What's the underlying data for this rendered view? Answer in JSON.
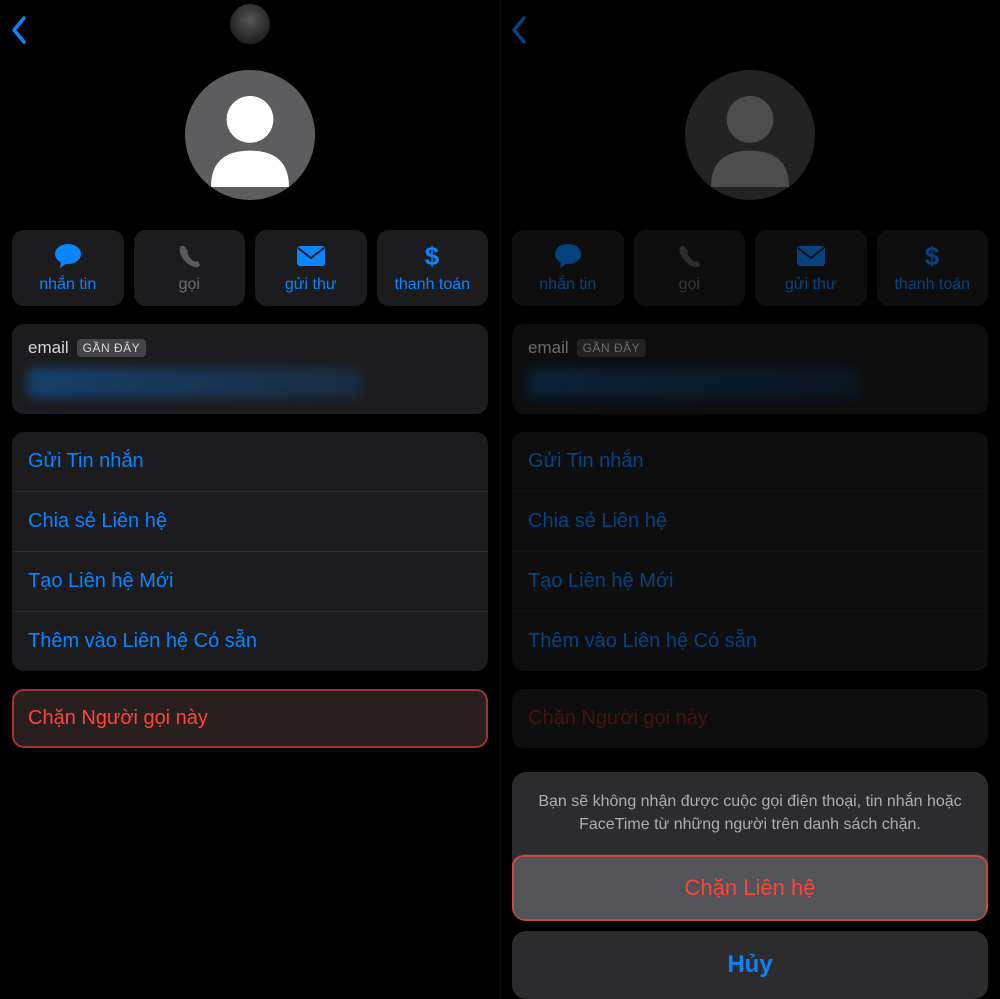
{
  "actions": {
    "message": "nhắn tin",
    "call": "gọi",
    "mail": "gửi thư",
    "pay": "thanh toán"
  },
  "email": {
    "label": "email",
    "badge": "GẦN ĐÂY"
  },
  "list": {
    "send_message": "Gửi Tin nhắn",
    "share_contact": "Chia sẻ Liên hệ",
    "create_contact": "Tạo Liên hệ Mới",
    "add_existing": "Thêm vào Liên hệ Có sẵn"
  },
  "block": {
    "label": "Chặn Người gọi này"
  },
  "sheet": {
    "message": "Bạn sẽ không nhận được cuộc gọi điện thoại, tin nhắn hoặc FaceTime từ những người trên danh sách chặn.",
    "confirm": "Chặn Liên hệ",
    "cancel": "Hủy"
  }
}
